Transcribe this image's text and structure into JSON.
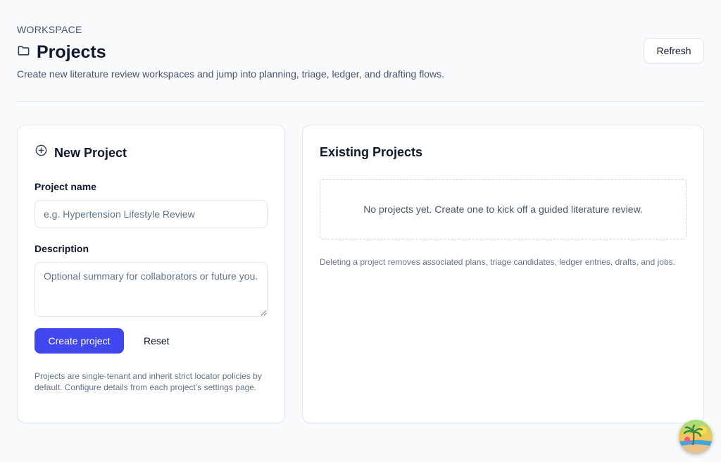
{
  "header": {
    "eyebrow": "WORKSPACE",
    "title": "Projects",
    "title_icon": "folder-icon",
    "subtitle": "Create new literature review workspaces and jump into planning, triage, ledger, and drafting flows.",
    "refresh_label": "Refresh"
  },
  "new_project": {
    "title": "New Project",
    "title_icon": "plus-circle-icon",
    "name_label": "Project name",
    "name_value": "",
    "name_placeholder": "e.g. Hypertension Lifestyle Review",
    "description_label": "Description",
    "description_value": "",
    "description_placeholder": "Optional summary for collaborators or future you.",
    "create_label": "Create project",
    "reset_label": "Reset",
    "help_text": "Projects are single-tenant and inherit strict locator policies by default. Configure details from each project’s settings page."
  },
  "existing_projects": {
    "title": "Existing Projects",
    "empty_message": "No projects yet. Create one to kick off a guided literature review.",
    "note": "Deleting a project removes associated plans, triage candidates, ledger entries, drafts, and jobs."
  },
  "assistant": {
    "icon": "beach-avatar-icon"
  },
  "colors": {
    "accent": "#4147ee",
    "background": "#f8fafc",
    "border": "#e2e8f0",
    "muted_text": "#64748b"
  }
}
